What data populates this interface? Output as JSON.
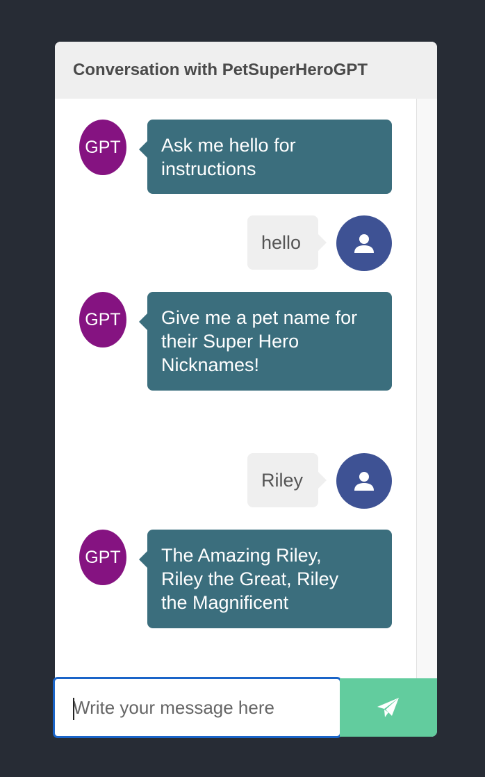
{
  "header": {
    "title": "Conversation with PetSuperHeroGPT"
  },
  "gpt_avatar_label": "GPT",
  "messages": [
    {
      "sender": "gpt",
      "lines": [
        "Ask me hello for",
        "instructions"
      ]
    },
    {
      "sender": "user",
      "text": "hello"
    },
    {
      "sender": "gpt",
      "lines": [
        "Give me a pet name for",
        "their Super Hero",
        "Nicknames!"
      ]
    },
    {
      "sender": "user",
      "text": "Riley"
    },
    {
      "sender": "gpt",
      "lines": [
        "The Amazing Riley,",
        "Riley the Great, Riley",
        "the Magnificent"
      ]
    }
  ],
  "composer": {
    "placeholder": "Write your message here",
    "value": ""
  },
  "icons": {
    "user_avatar": "user-icon",
    "send": "paper-plane-icon"
  },
  "colors": {
    "gpt_avatar": "#851381",
    "gpt_bubble": "#3b6e7d",
    "user_avatar": "#3e5294",
    "user_bubble": "#efefef",
    "send_button": "#62cc9e",
    "input_focus_border": "#1a64c8"
  }
}
